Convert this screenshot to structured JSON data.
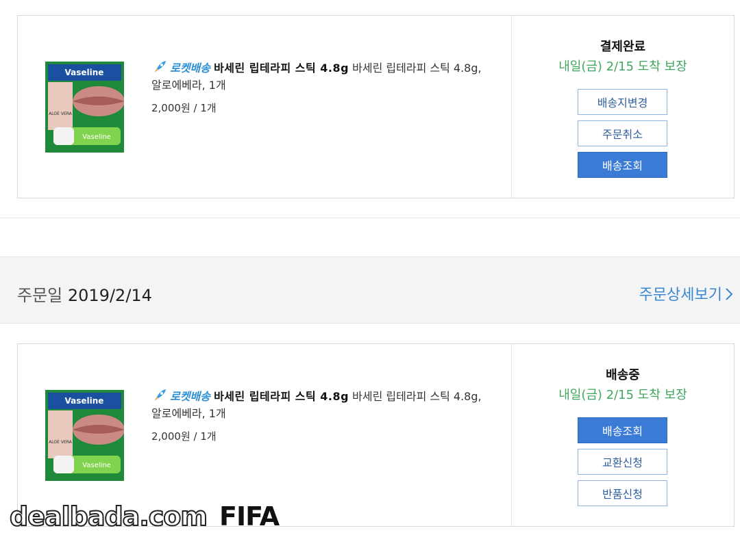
{
  "orders": [
    {
      "rocket_label": "로켓배송",
      "product_name": "바세린 립테라피 스틱 4.8g",
      "product_desc": " 바세린 립테라피 스틱 4.8g, 알로에베라, 1개",
      "price": "2,000원 / 1개",
      "status": "결제완료",
      "arrival": "내일(금) 2/15 도착 보장",
      "buttons": [
        "배송지변경",
        "주문취소",
        "배송조회"
      ]
    },
    {
      "rocket_label": "로켓배송",
      "product_name": "바세린 립테라피 스틱 4.8g",
      "product_desc": " 바세린 립테라피 스틱 4.8g, 알로에베라, 1개",
      "price": "2,000원 / 1개",
      "status": "배송중",
      "arrival": "내일(금) 2/15 도착 보장",
      "buttons": [
        "배송조회",
        "교환신청",
        "반품신청"
      ]
    }
  ],
  "order_header": {
    "date_label": "주문일",
    "date_value": "2019/2/14",
    "detail_link": "주문상세보기"
  },
  "product_image": {
    "brand": "Vaseline",
    "variant": "ALOE VERA"
  },
  "watermark": {
    "site": "dealbada.com",
    "tag": "FIFA"
  },
  "colors": {
    "accent_blue": "#3a7bd5",
    "arrival_green": "#3fa75e",
    "link_blue": "#3a86d6"
  }
}
